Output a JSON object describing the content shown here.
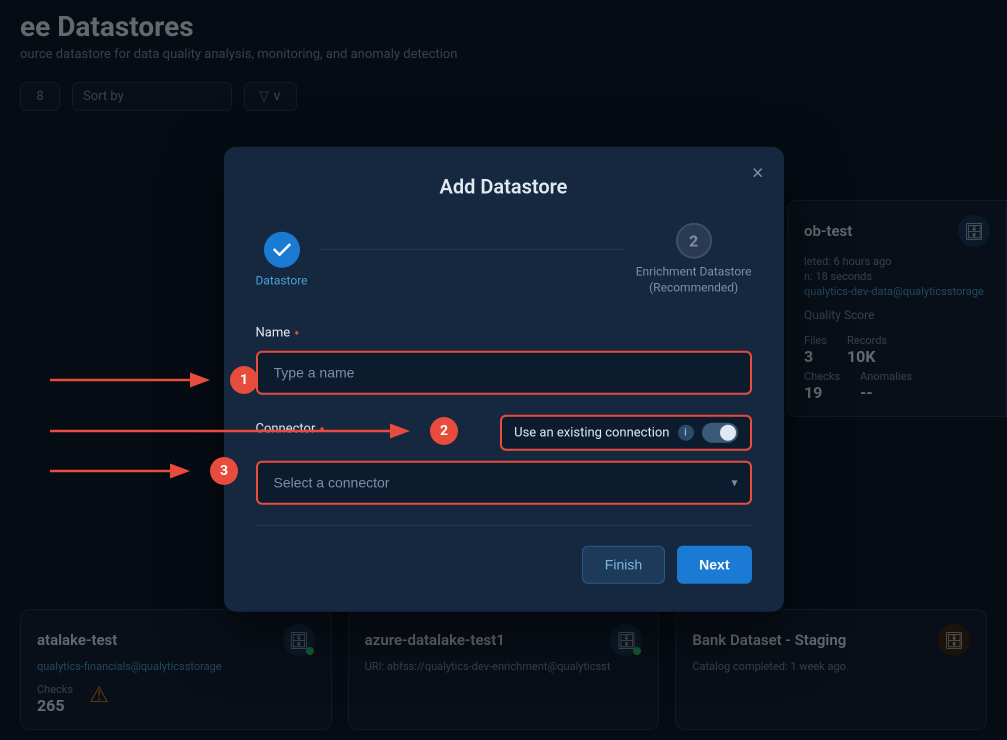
{
  "page": {
    "title": "ee Datastores",
    "subtitle": "ource datastore for data quality analysis, monitoring, and anomaly detection"
  },
  "modal": {
    "title": "Add Datastore",
    "close_label": "×",
    "steps": [
      {
        "number": "✓",
        "label": "Datastore",
        "state": "active"
      },
      {
        "number": "2",
        "label": "Enrichment Datastore\n(Recommended)",
        "state": "inactive"
      }
    ],
    "name_field": {
      "label": "Name",
      "placeholder": "Type a name",
      "required": true
    },
    "connector_field": {
      "label": "Connector",
      "required": true,
      "toggle_label": "Use an existing connection",
      "select_placeholder": "Select a connector"
    },
    "buttons": {
      "finish": "Finish",
      "next": "Next"
    }
  },
  "annotations": [
    {
      "id": "1",
      "label": "1"
    },
    {
      "id": "2",
      "label": "2"
    },
    {
      "id": "3",
      "label": "3"
    }
  ],
  "background": {
    "sort_label": "Sort by",
    "card1": {
      "title": "ob-test",
      "meta_completed": "leted: 6 hours ago",
      "meta_duration": "n: 18 seconds",
      "meta_link": "qualytics-dev-data@qualyticsstorage",
      "quality_score": "Quality Score",
      "files_label": "Files",
      "files_value": "3",
      "records_label": "Records",
      "records_value": "10K",
      "checks_label": "Checks",
      "checks_value": "19",
      "anomalies_label": "Anomalies",
      "anomalies_value": "--"
    },
    "bottom_cards": [
      {
        "title": "atalake-test",
        "link": "qualytics-financials@qualyticsstorage",
        "checks_label": "Checks",
        "checks_value": "265"
      },
      {
        "title": "azure-datalake-test1",
        "uri": "URI: abfss://qualytics-dev-enrichment@qualyticsst",
        "checks_label": "",
        "checks_value": ""
      },
      {
        "title": "Bank Dataset - Staging",
        "meta": "Catalog completed: 1 week ago"
      }
    ]
  },
  "icons": {
    "close": "×",
    "check": "✓",
    "info": "i",
    "warning": "⚠",
    "database": "🗄",
    "arrow_down": "▾"
  }
}
